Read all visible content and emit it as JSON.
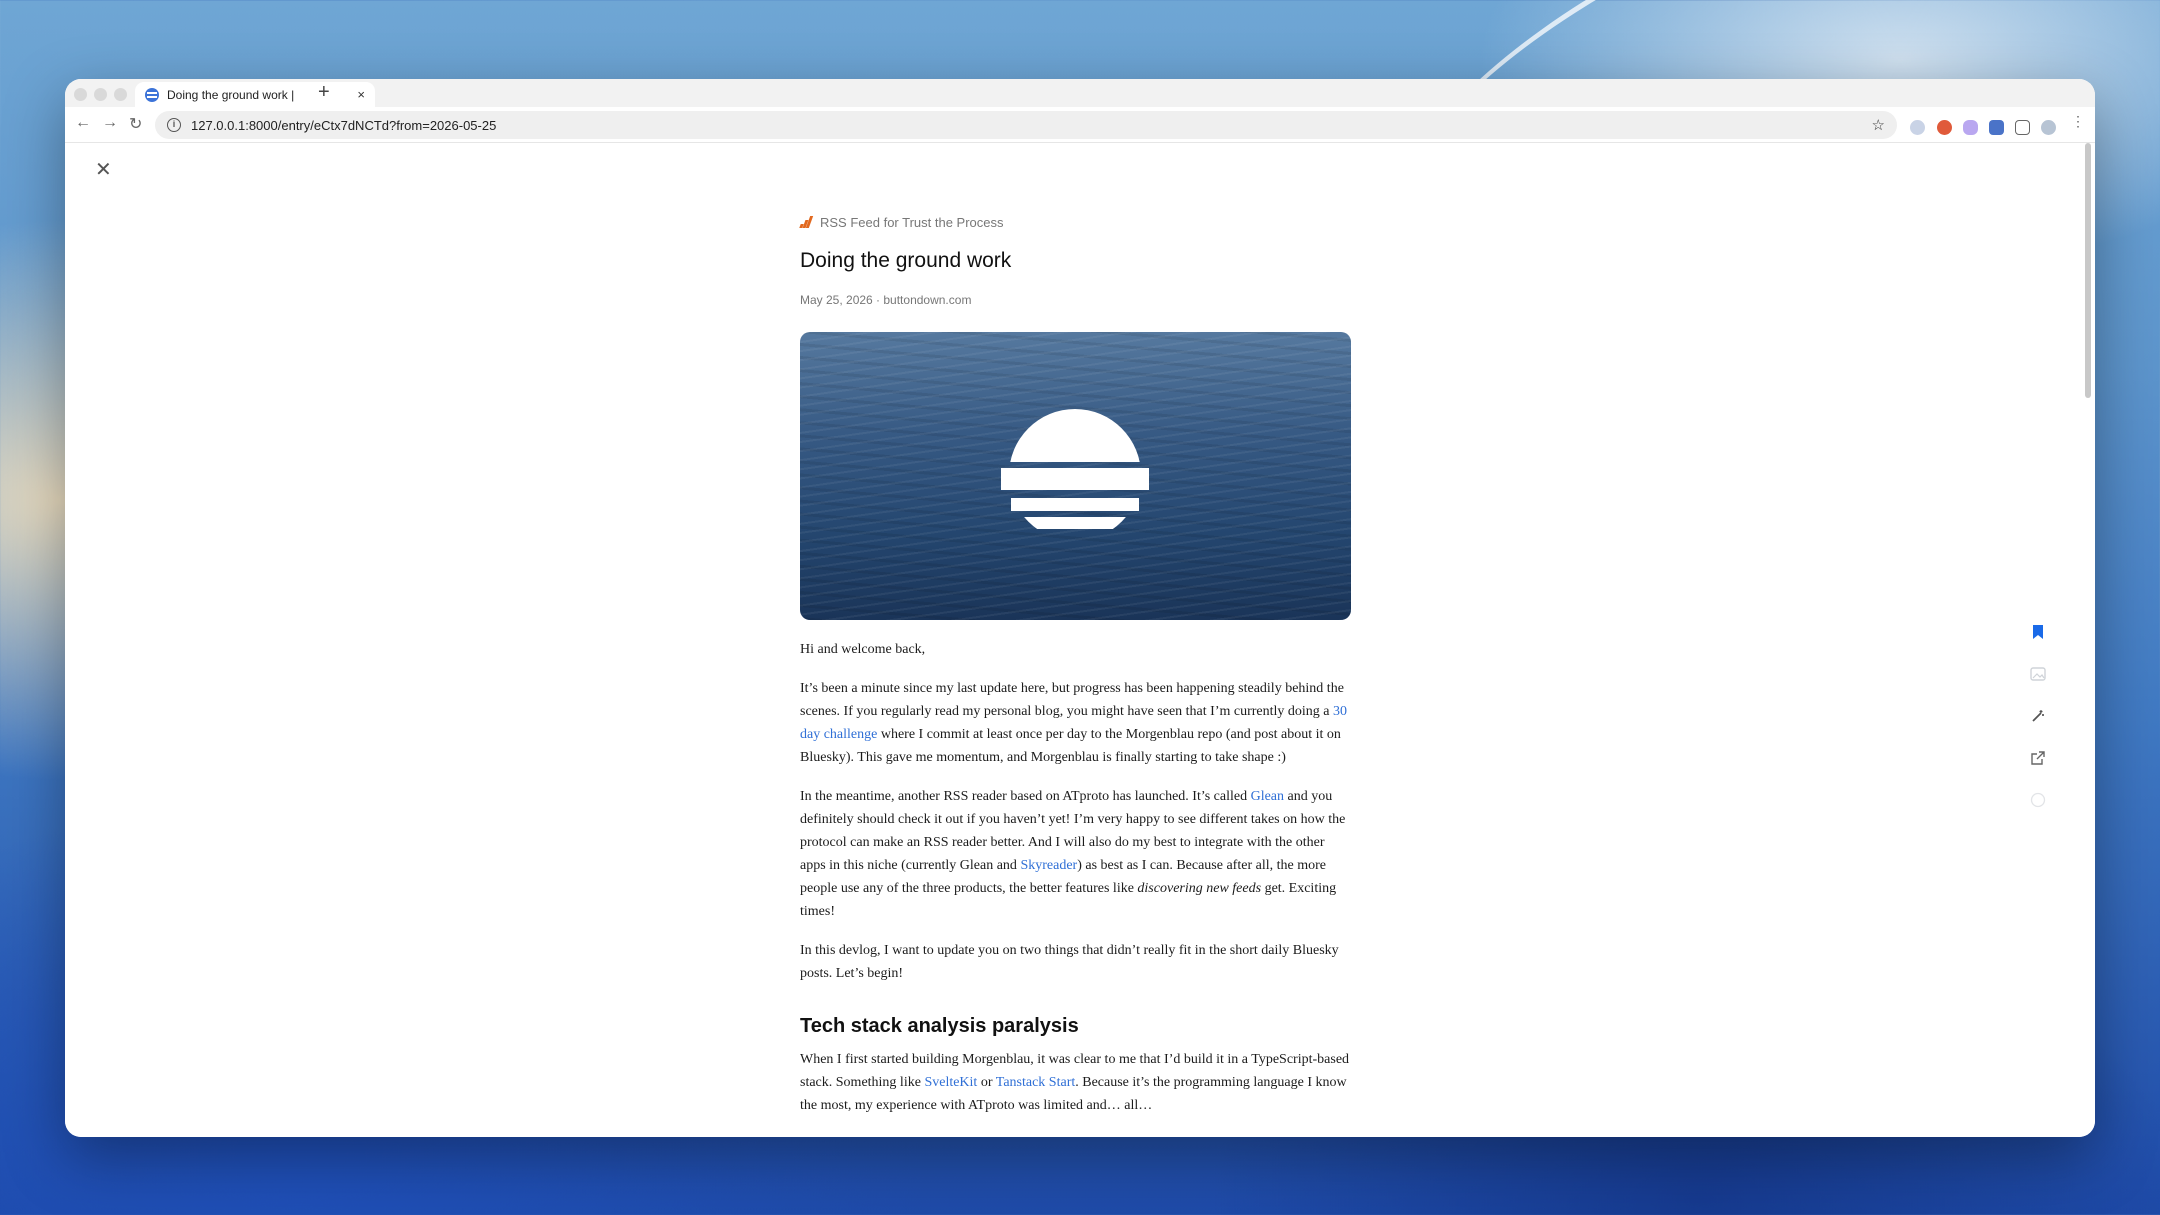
{
  "browser": {
    "tab": {
      "title": "Doing the ground work |",
      "close_glyph": "×"
    },
    "new_tab_glyph": "+",
    "nav": {
      "back": "←",
      "forward": "→",
      "reload": "↻"
    },
    "url": "127.0.0.1:8000/entry/eCtx7dNCTd?from=2026-05-25",
    "star_glyph": "☆",
    "info_glyph": "i"
  },
  "reader": {
    "close_glyph": "✕",
    "feed_name": "RSS Feed for Trust the Process",
    "title": "Doing the ground work",
    "meta": "May 25, 2026 · buttondown.com",
    "hero_icon": "sunset-stripes-logo",
    "paragraphs": {
      "p1": "Hi and welcome back,",
      "p2_a": "It’s been a minute since my last update here, but progress has been happening steadily behind the scenes. If you regularly read my personal blog, you might have seen that I’m currently doing a ",
      "p2_link": "30 day challenge",
      "p2_b": " where I commit at least once per day to the Morgenblau repo (and post about it on Bluesky). This gave me momentum, and Morgenblau is finally starting to take shape :)",
      "p3_a": "In the meantime, another RSS reader based on ATproto has launched. It’s called ",
      "p3_link1": "Glean",
      "p3_b": " and you definitely should check it out if you haven’t yet! I’m very happy to see different takes on how the protocol can make an RSS reader better. And I will also do my best to integrate with the other apps in this niche (currently Glean and ",
      "p3_link2": "Skyreader",
      "p3_c": ") as best as I can. Because after all, the more people use any of the three products, the better features like ",
      "p3_em": "discovering new feeds",
      "p3_d": " get. Exciting times!",
      "p4": "In this devlog, I want to update you on two things that didn’t really fit in the short daily Bluesky posts. Let’s begin!",
      "h2": "Tech stack analysis paralysis",
      "p5_a": "When I first started building Morgenblau, it was clear to me that I’d build it in a TypeScript-based stack. Something like ",
      "p5_link1": "SvelteKit",
      "p5_b": " or ",
      "p5_link2": "Tanstack Start",
      "p5_c": ". Because it’s the programming language I know the most, my experience with ATproto was limited and… all…"
    }
  },
  "side_actions": [
    "bookmark-icon",
    "image-icon",
    "magic-wand-icon",
    "share-icon",
    "circle-icon"
  ],
  "colors": {
    "accent": "#2f6fd6",
    "feed_icon": "#e2691f",
    "bookmark": "#1a6ae8"
  }
}
